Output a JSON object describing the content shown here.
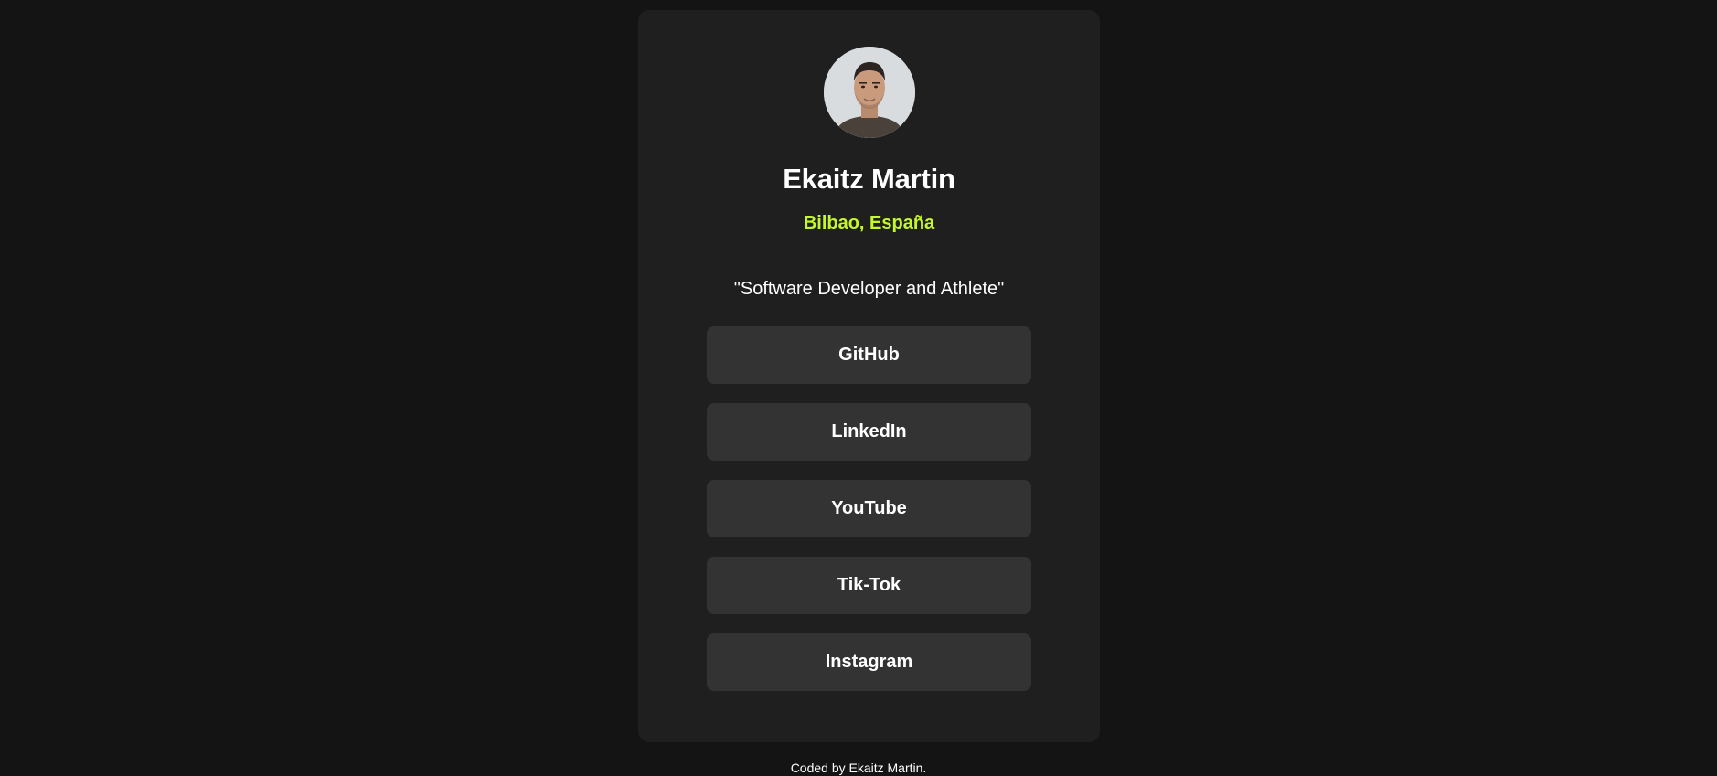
{
  "profile": {
    "avatar_alt": "profile-photo",
    "name": "Ekaitz Martin",
    "location": "Bilbao, España",
    "bio": "\"Software Developer and Athlete\""
  },
  "links": [
    {
      "label": "GitHub"
    },
    {
      "label": "LinkedIn"
    },
    {
      "label": "YouTube"
    },
    {
      "label": "Tik-Tok"
    },
    {
      "label": "Instagram"
    }
  ],
  "footer": {
    "text": "Coded by Ekaitz Martin."
  },
  "colors": {
    "background": "#141414",
    "card": "#1f1f1f",
    "button": "#333333",
    "accent": "#c4f82a",
    "text": "#ffffff"
  }
}
